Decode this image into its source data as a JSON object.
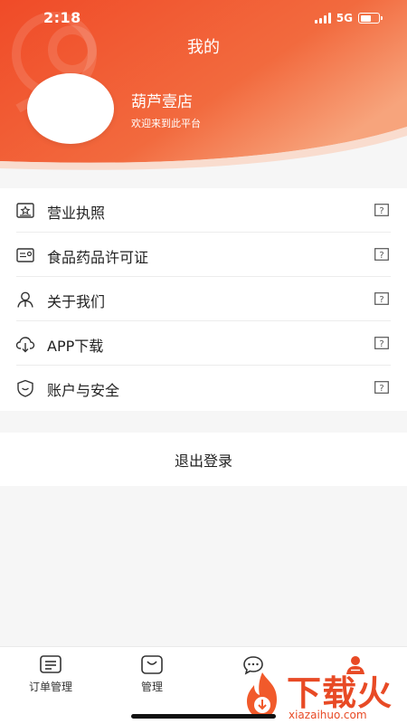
{
  "status_bar": {
    "time": "2:18",
    "network": "5G"
  },
  "header": {
    "title": "我的",
    "shop_name": "葫芦壹店",
    "welcome": "欢迎来到此平台"
  },
  "menu": {
    "items": [
      {
        "label": "营业执照",
        "icon": "license-icon"
      },
      {
        "label": "食品药品许可证",
        "icon": "id-card-icon"
      },
      {
        "label": "关于我们",
        "icon": "person-icon"
      },
      {
        "label": "APP下载",
        "icon": "cloud-download-icon"
      },
      {
        "label": "账户与安全",
        "icon": "shield-icon"
      }
    ]
  },
  "logout_label": "退出登录",
  "tabbar": {
    "items": [
      {
        "label": "订单管理",
        "icon": "order-list-icon"
      },
      {
        "label": "管理",
        "icon": "management-icon"
      },
      {
        "label": "",
        "icon": "message-icon"
      },
      {
        "label": "",
        "icon": "user-icon"
      }
    ]
  },
  "watermark": {
    "text": "下载火",
    "url": "xiazaihuo.com"
  },
  "colors": {
    "header_gradient_start": "#f2532a",
    "header_gradient_end": "#f7a47c",
    "accent": "#e84a25"
  }
}
